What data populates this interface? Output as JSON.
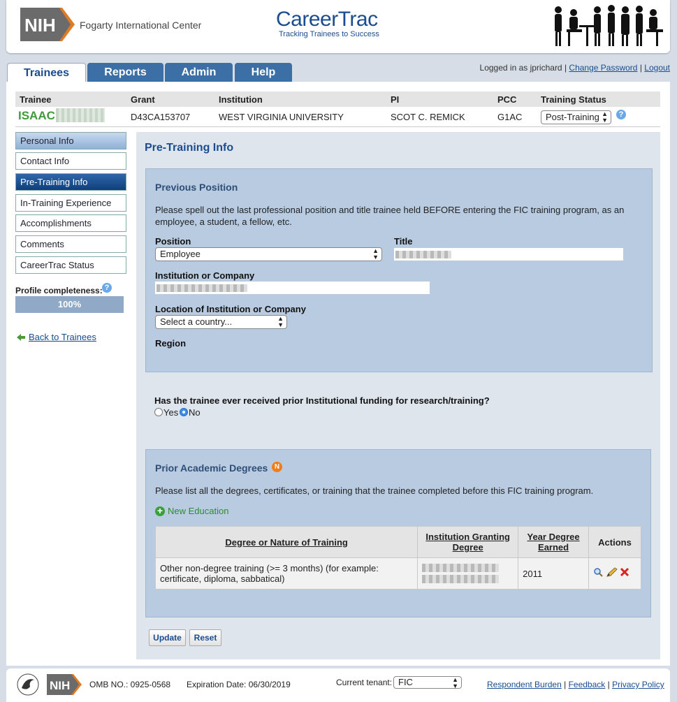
{
  "header": {
    "nih_logo_text": "NIH",
    "agency": "Fogarty International Center",
    "app_title": "CareerTrac",
    "app_subtitle": "Tracking Trainees to Success"
  },
  "tabs": [
    "Trainees",
    "Reports",
    "Admin",
    "Help"
  ],
  "user": {
    "logged_in_text": "Logged in as jprichard",
    "change_password": "Change Password",
    "logout": "Logout",
    "separator": "|"
  },
  "trainee_table": {
    "headers": [
      "Trainee",
      "Grant",
      "Institution",
      "PI",
      "PCC",
      "Training Status"
    ],
    "name": "ISAAC",
    "grant": "D43CA153707",
    "institution": "WEST VIRGINIA UNIVERSITY",
    "pi": "SCOT C. REMICK",
    "pcc": "G1AC",
    "status": "Post-Training"
  },
  "sidebar": {
    "items": [
      "Personal Info",
      "Contact Info",
      "Pre-Training Info",
      "In-Training Experience",
      "Accomplishments",
      "Comments",
      "CareerTrac Status"
    ],
    "completeness_label": "Profile completeness:",
    "completeness_value": "100%",
    "back_link": "Back to Trainees"
  },
  "content": {
    "page_title": "Pre-Training Info",
    "previous_position": {
      "title": "Previous Position",
      "instructions": "Please spell out the last professional position and title trainee held BEFORE entering the FIC training program, as an employee, a student, a fellow, etc.",
      "position_label": "Position",
      "position_value": "Employee",
      "title_label": "Title",
      "institution_label": "Institution or Company",
      "location_label": "Location of Institution or Company",
      "location_value": "Select a country...",
      "region_label": "Region"
    },
    "funding_question": "Has the trainee ever received prior Institutional funding for research/training?",
    "funding_yes": "Yes",
    "funding_no": "No",
    "degrees": {
      "title": "Prior Academic Degrees",
      "badge": "N",
      "instructions": "Please list all the degrees, certificates, or training that the trainee completed before this FIC training program.",
      "new_button": "New Education",
      "columns": [
        "Degree or Nature of Training",
        "Institution Granting Degree",
        "Year Degree Earned",
        "Actions"
      ],
      "rows": [
        {
          "degree": "Other non-degree training (>= 3 months) (for example: certificate, diploma, sabbatical)",
          "year": "2011"
        }
      ]
    },
    "update_button": "Update",
    "reset_button": "Reset"
  },
  "footer": {
    "omb": "OMB NO.: 0925-0568",
    "expiration": "Expiration Date: 06/30/2019",
    "tenant_label": "Current tenant:",
    "tenant_value": "FIC",
    "links": [
      "Respondent Burden",
      "Feedback",
      "Privacy Policy"
    ]
  }
}
